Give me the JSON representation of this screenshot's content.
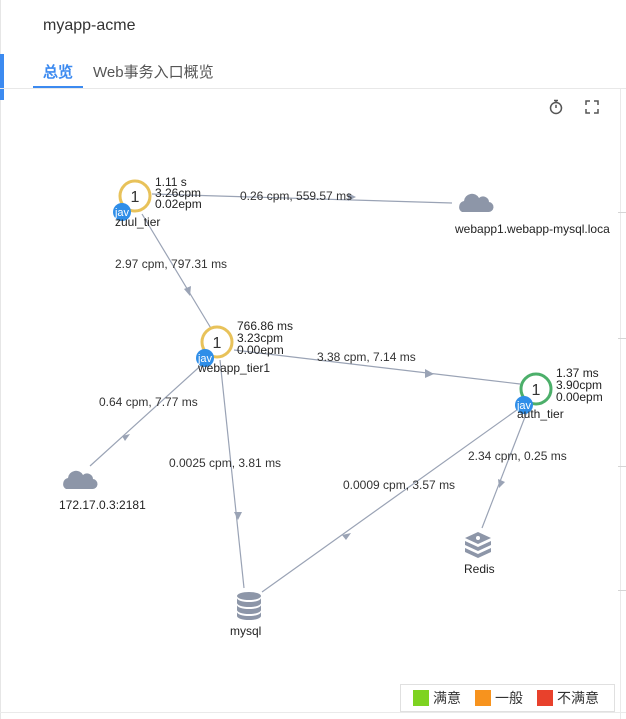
{
  "app": {
    "title": "myapp-acme"
  },
  "tabs": [
    {
      "label": "总览",
      "active": true
    },
    {
      "label": "Web事务入口概览",
      "active": false
    }
  ],
  "toolbar": {
    "timer_icon": "stopwatch-icon",
    "fullscreen_icon": "fullscreen-icon"
  },
  "colors": {
    "accent": "#3c8af0",
    "tier_ring": "#e8c25a",
    "tier_ring_good": "#4caf6a",
    "badge": "#2f8ee8",
    "edge": "#9aa3b5",
    "resource_icon": "#8d96a8"
  },
  "graph": {
    "nodes": [
      {
        "id": "zuul_tier",
        "kind": "tier",
        "count": "1",
        "name": "zuul_tier",
        "badge": "jav",
        "metrics": [
          "1.11 s",
          "3.26cpm",
          "0.02epm"
        ],
        "status": "warning"
      },
      {
        "id": "webapp_tier1",
        "kind": "tier",
        "count": "1",
        "name": "webapp_tier1",
        "badge": "jav",
        "metrics": [
          "766.86 ms",
          "3.23cpm",
          "0.00epm"
        ],
        "status": "warning"
      },
      {
        "id": "auth_tier",
        "kind": "tier",
        "count": "1",
        "name": "auth_tier",
        "badge": "jav",
        "metrics": [
          "1.37 ms",
          "3.90cpm",
          "0.00epm"
        ],
        "status": "good"
      },
      {
        "id": "mysql_remote",
        "kind": "cloud",
        "name": "webapp1.webapp-mysql.loca"
      },
      {
        "id": "zookeeper",
        "kind": "cloud",
        "name": "172.17.0.3:2181"
      },
      {
        "id": "mysql",
        "kind": "database",
        "name": "mysql"
      },
      {
        "id": "redis",
        "kind": "redis",
        "name": "Redis"
      }
    ],
    "edges": [
      {
        "from": "zuul_tier",
        "to": "mysql_remote",
        "label": "0.26 cpm, 559.57 ms"
      },
      {
        "from": "zuul_tier",
        "to": "webapp_tier1",
        "label": "2.97 cpm, 797.31 ms"
      },
      {
        "from": "webapp_tier1",
        "to": "auth_tier",
        "label": "3.38 cpm, 7.14 ms"
      },
      {
        "from": "webapp_tier1",
        "to": "zookeeper",
        "label": "0.64 cpm, 7.77 ms"
      },
      {
        "from": "webapp_tier1",
        "to": "mysql",
        "label": "0.0025 cpm, 3.81 ms"
      },
      {
        "from": "auth_tier",
        "to": "mysql",
        "label": "0.0009 cpm, 3.57 ms"
      },
      {
        "from": "auth_tier",
        "to": "redis",
        "label": "2.34 cpm, 0.25 ms"
      }
    ]
  },
  "legend": [
    {
      "label": "满意",
      "color": "#7ed321"
    },
    {
      "label": "一般",
      "color": "#f7931e"
    },
    {
      "label": "不满意",
      "color": "#e8412c"
    }
  ]
}
